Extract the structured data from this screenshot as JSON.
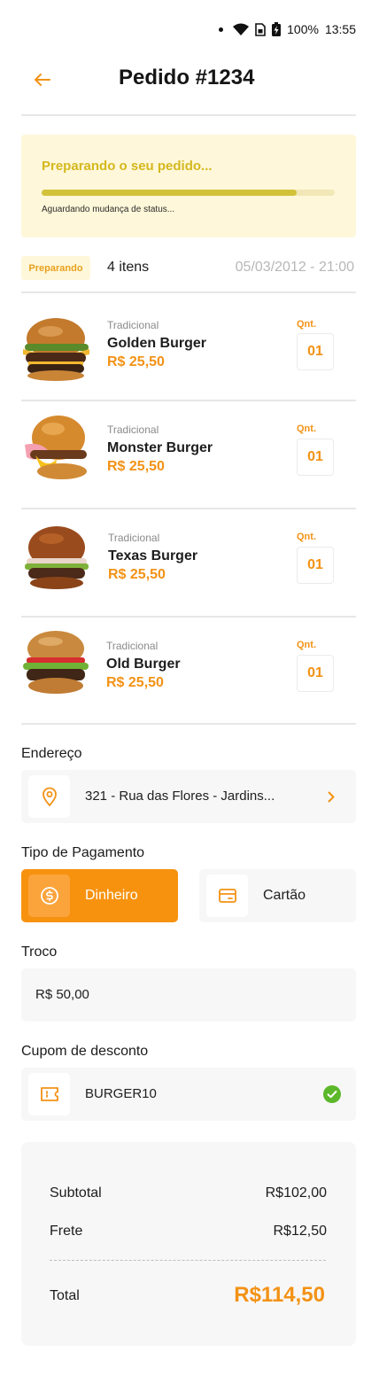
{
  "status_bar": {
    "battery": "100%",
    "time": "13:55"
  },
  "header": {
    "title": "Pedido #1234"
  },
  "order_status": {
    "title": "Preparando o seu pedido...",
    "subtitle": "Aguardando mudança de status...",
    "progress": 0.87
  },
  "summary": {
    "badge": "Preparando",
    "item_count": "4 itens",
    "date": "05/03/2012 - 21:00"
  },
  "items": [
    {
      "category": "Tradicional",
      "name": "Golden Burger",
      "price": "R$ 25,50",
      "qty_label": "Qnt.",
      "qty": "01"
    },
    {
      "category": "Tradicional",
      "name": "Monster Burger",
      "price": "R$ 25,50",
      "qty_label": "Qnt.",
      "qty": "01"
    },
    {
      "category": "Tradicional",
      "name": "Texas Burger",
      "price": "R$ 25,50",
      "qty_label": "Qnt.",
      "qty": "01"
    },
    {
      "category": "Tradicional",
      "name": "Old Burger",
      "price": "R$ 25,50",
      "qty_label": "Qnt.",
      "qty": "01"
    }
  ],
  "address": {
    "label": "Endereço",
    "value": "321 - Rua das Flores - Jardins..."
  },
  "payment": {
    "label": "Tipo de Pagamento",
    "cash": "Dinheiro",
    "card": "Cartão",
    "selected": "cash"
  },
  "change": {
    "label": "Troco",
    "value": "R$ 50,00"
  },
  "coupon": {
    "label": "Cupom de desconto",
    "value": "BURGER10"
  },
  "totals": {
    "subtotal_label": "Subtotal",
    "subtotal": "R$102,00",
    "shipping_label": "Frete",
    "shipping": "R$12,50",
    "total_label": "Total",
    "total": "R$114,50"
  },
  "colors": {
    "accent": "#f39215",
    "status_bg": "#fff7d9",
    "status_text": "#d4b81e",
    "success": "#5cb82a"
  },
  "icons": [
    "arrow-left-icon",
    "location-pin-icon",
    "chevron-right-icon",
    "dollar-coin-icon",
    "credit-card-icon",
    "ticket-icon",
    "check-circle-icon"
  ]
}
